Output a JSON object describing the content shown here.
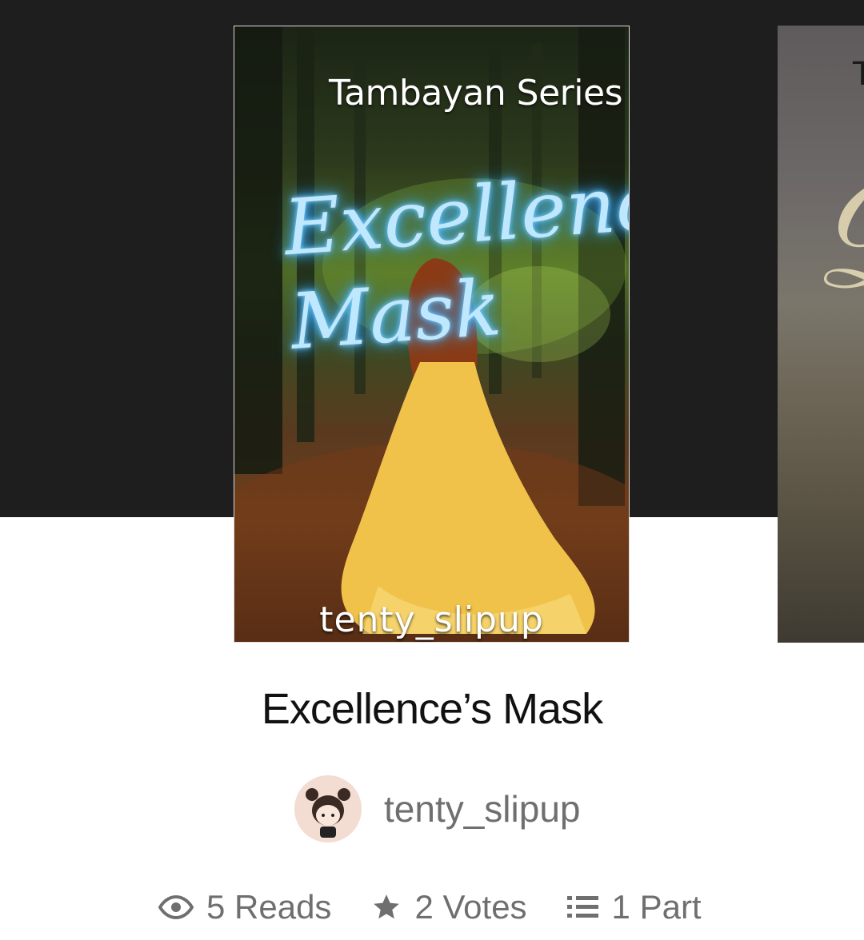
{
  "cover": {
    "series_text": "Tambayan Series",
    "title_text": "Excellence's Mask",
    "author_text": "tenty_slipup"
  },
  "next_cover": {
    "letter": "T"
  },
  "story": {
    "title": "Excellence’s Mask",
    "author": "tenty_slipup"
  },
  "stats": {
    "reads": "5 Reads",
    "votes": "2 Votes",
    "parts": "1 Part"
  },
  "icons": {
    "reads": "eye-icon",
    "votes": "star-icon",
    "parts": "list-icon"
  },
  "colors": {
    "top_band": "#1e1e1e",
    "text_dark": "#111111",
    "text_gray": "#6f6f6f",
    "title_glow": "#bfe8ff"
  }
}
